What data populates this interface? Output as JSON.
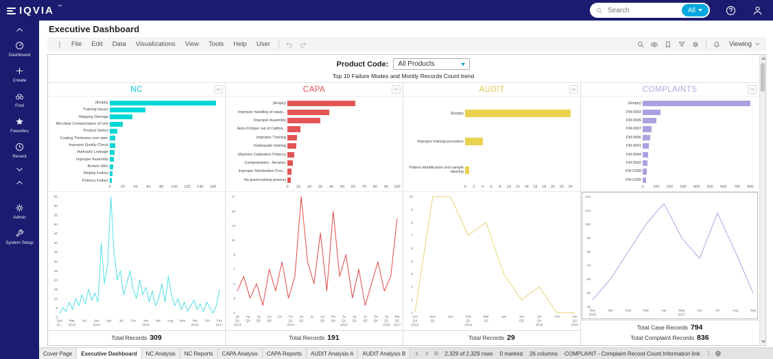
{
  "colors": {
    "brand_bar": "#1b1b6f",
    "accent_blue": "#00a7e1"
  },
  "topbar": {
    "logo_text": "IQVIA",
    "logo_tm": "™",
    "search_placeholder": "Search",
    "scope_button_label": "All",
    "search_icon": "search",
    "help_icon": "question",
    "user_icon": "user"
  },
  "sidebar": {
    "items": [
      {
        "name": "sidebar-collapse",
        "icon": "chevron-up",
        "label": ""
      },
      {
        "name": "sidebar-item-dashboard",
        "icon": "dashboard",
        "label": "Dashboard"
      },
      {
        "name": "sidebar-item-create",
        "icon": "plus",
        "label": "Create"
      },
      {
        "name": "sidebar-item-find",
        "icon": "binoculars",
        "label": "Find"
      },
      {
        "name": "sidebar-item-favorites",
        "icon": "star",
        "label": "Favorites"
      },
      {
        "name": "sidebar-item-recent",
        "icon": "clock",
        "label": "Recent"
      },
      {
        "name": "sidebar-scroll-down",
        "icon": "chevron-down",
        "label": ""
      },
      {
        "name": "sidebar-scroll-up",
        "icon": "chevron-up",
        "label": ""
      },
      {
        "name": "sidebar-item-admin",
        "icon": "gear",
        "label": "Admin",
        "gap_before": true
      },
      {
        "name": "sidebar-item-system-setup",
        "icon": "wrench",
        "label": "System Setup"
      }
    ]
  },
  "page": {
    "title": "Executive Dashboard"
  },
  "menubar": {
    "kebab_icon": "kebab",
    "menus": [
      "File",
      "Edit",
      "Data",
      "Visualizations",
      "View",
      "Tools",
      "Help",
      "User"
    ],
    "history_icons": [
      "undo",
      "redo"
    ],
    "right_icons": [
      "search",
      "eye",
      "bookmark",
      "funnel",
      "gear",
      "bell"
    ],
    "viewing_label": "Viewing"
  },
  "dashboard": {
    "product_code_label": "Product Code:",
    "product_code_value": "All Products",
    "subtitle": "Top 10 Failure Modes and Montly Records Count trend"
  },
  "chart_data": {
    "type": "dashboard",
    "panels": [
      {
        "id": "nc",
        "title": "NC",
        "title_color": "#00c4da",
        "bar_color": "#00d6d6",
        "line_color": "#5ce0e6",
        "bar": {
          "type": "bar",
          "categories": [
            "(Empty)",
            "Training Issues",
            "Shipping Damage",
            "Microbial Contamination of Unit",
            "Product Defect",
            "Coating Thickness over spec",
            "Improper Quality Check",
            "Hydraulic Leakage",
            "Improper Assembly",
            "Broken Wire",
            "Display Failure",
            "Potency Failure"
          ],
          "values": [
            165,
            55,
            35,
            20,
            12,
            9,
            8,
            7,
            6,
            5,
            4,
            3
          ],
          "xticks": [
            0,
            20,
            40,
            60,
            80,
            100,
            120,
            140,
            160
          ],
          "xmax": 170
        },
        "line": {
          "type": "line",
          "ymin": 0,
          "ymax": 65,
          "yticks": [
            0,
            5,
            10,
            15,
            20,
            25,
            30,
            35,
            40,
            45,
            50,
            55,
            60,
            65
          ],
          "xticks": [
            "Dec\n20...",
            "Mar\n2013",
            "Jul",
            "Jan\n2014",
            "Apr",
            "Jul",
            "Oct",
            "Jan\n2015",
            "Ma",
            "Aug",
            "Nov",
            "Ma\n2016",
            "Oct",
            "Feb\n2017"
          ],
          "values": [
            2,
            5,
            3,
            8,
            4,
            10,
            6,
            12,
            7,
            15,
            9,
            13,
            8,
            40,
            18,
            28,
            65,
            35,
            20,
            25,
            12,
            18,
            25,
            15,
            10,
            20,
            12,
            16,
            8,
            14,
            6,
            10,
            18,
            8,
            22,
            12,
            6,
            10,
            4,
            8,
            3,
            6,
            9,
            4,
            7,
            3,
            8,
            5,
            2,
            6,
            15
          ]
        },
        "footer": [
          {
            "label": "Total Records",
            "value": "309"
          }
        ]
      },
      {
        "id": "capa",
        "title": "CAPA",
        "title_color": "#e14b4b",
        "bar_color": "#e25555",
        "line_color": "#e25555",
        "bar": {
          "type": "bar",
          "categories": [
            "(Empty)",
            "Improper handling of equip...",
            "Improper Assembly",
            "Auto-Crimper out of Calibra...",
            "Improper Training",
            "Inadequate training",
            "Machine Calibration Potency",
            "Contamination - Aeration",
            "Improper Sterilization Proc...",
            "No good training process"
          ],
          "values": [
            62,
            38,
            30,
            12,
            9,
            8,
            6,
            5,
            4,
            3
          ],
          "xticks": [
            0,
            10,
            20,
            30,
            40,
            50,
            60,
            70,
            80,
            90,
            100
          ],
          "xmax": 100
        },
        "line": {
          "type": "line",
          "ymin": 1,
          "ymax": 17,
          "yticks": [
            1,
            3,
            5,
            7,
            9,
            11,
            13,
            15,
            17
          ],
          "xticks": [
            "Ja\nQ1\n2013",
            "Ap\nQ2",
            "Ju\nQ3",
            "Au\nQ4",
            "Oc",
            "Fe\nQ1\n2014",
            "Ap\nQ2",
            "Ju",
            "Au\nQ3",
            "No\nQ4",
            "Ja\nQ1\n2015",
            "Ap\nQ2",
            "Ju\nQ3",
            "Oc\nQ4",
            "Ja\nQ1\n2016",
            "Ma\nQ2\n2017"
          ],
          "values": [
            4,
            6,
            3,
            5,
            2,
            7,
            4,
            8,
            3,
            6,
            17,
            8,
            5,
            12,
            4,
            15,
            6,
            9,
            3,
            7,
            2,
            5,
            8,
            4,
            6,
            14
          ]
        },
        "footer": [
          {
            "label": "Total Records",
            "value": "191"
          }
        ]
      },
      {
        "id": "audit",
        "title": "AUDIT",
        "title_color": "#e2c64b",
        "bar_color": "#ead24f",
        "line_color": "#e8d780",
        "bar": {
          "type": "bar",
          "categories": [
            "(Empty)",
            "Improper training procedure",
            "Patient identification and sample labeling"
          ],
          "values": [
            24,
            4,
            1
          ],
          "xticks": [
            0,
            2,
            4,
            6,
            8,
            10,
            12,
            14,
            16,
            18,
            20,
            22,
            24
          ],
          "xmax": 25
        },
        "line": {
          "type": "line",
          "ymin": 1,
          "ymax": 10,
          "yticks": [
            1,
            2,
            3,
            4,
            5,
            6,
            7,
            8,
            9,
            10
          ],
          "xticks": [
            "Oct\nQ4\n2013",
            "Nov\nQ1",
            "Jan",
            "Feb\nQ1\n2014",
            "Mar\nQ2",
            "Apr",
            "Jun\nQ3",
            "Jul\nQ4\n2015",
            "Oct",
            "Jun\nQ2\n2016"
          ],
          "values": [
            1,
            10,
            10,
            7,
            8,
            4,
            2,
            3,
            1,
            1
          ]
        },
        "footer": [
          {
            "label": "Total Records",
            "value": "29"
          }
        ]
      },
      {
        "id": "complaints",
        "title": "COMPLAINTS",
        "title_color": "#b1a6e3",
        "bar_color": "#aba1e0",
        "line_color": "#b4abe6",
        "bar": {
          "type": "bar",
          "categories": [
            "(Empty)",
            "FM-0003",
            "FM-0005",
            "FM-0007",
            "FM-0006",
            "FM-0001",
            "FM-0004",
            "FM-0002",
            "FM-C008",
            "FM-C005"
          ],
          "values": [
            800,
            130,
            100,
            65,
            55,
            48,
            42,
            36,
            30,
            25
          ],
          "xticks": [
            0,
            100,
            200,
            300,
            400,
            500,
            600,
            700,
            800
          ],
          "xmax": 820
        },
        "line": {
          "type": "line",
          "ymin": 40,
          "ymax": 120,
          "yticks": [
            40,
            50,
            60,
            70,
            80,
            90,
            100,
            110,
            120
          ],
          "xticks": [
            "Dec\n2016",
            "Jan",
            "Feb",
            "Mar",
            "Apr",
            "May\n2017",
            "Jun",
            "Jul",
            "Aug",
            "Sep"
          ],
          "values": [
            45,
            60,
            80,
            100,
            115,
            90,
            75,
            108,
            80,
            50
          ]
        },
        "footer": [
          {
            "label": "Total Case Records",
            "value": "794"
          },
          {
            "label": "Total Complaint Records",
            "value": "836"
          }
        ]
      }
    ]
  },
  "statusbar": {
    "tabs": [
      {
        "label": "Cover Page",
        "active": false
      },
      {
        "label": "Executive Dashboard",
        "active": true
      },
      {
        "label": "NC Analysis",
        "active": false
      },
      {
        "label": "NC Reports",
        "active": false
      },
      {
        "label": "CAPA Analysis",
        "active": false
      },
      {
        "label": "CAPA Reports",
        "active": false
      },
      {
        "label": "AUDIT Analysis A",
        "active": false
      },
      {
        "label": "AUDIT Analysis B",
        "active": false
      }
    ],
    "nav_icons": [
      "chevron-left",
      "chevron-right",
      "double-chevron-up"
    ],
    "rows_info": "2,329 of 2,329 rows",
    "marked_info": "0 marked",
    "columns_info": "26 columns",
    "link_info": "COMPLAINT - Complaint Record Count Information link",
    "right_icons": [
      "kebab",
      "globe"
    ]
  }
}
